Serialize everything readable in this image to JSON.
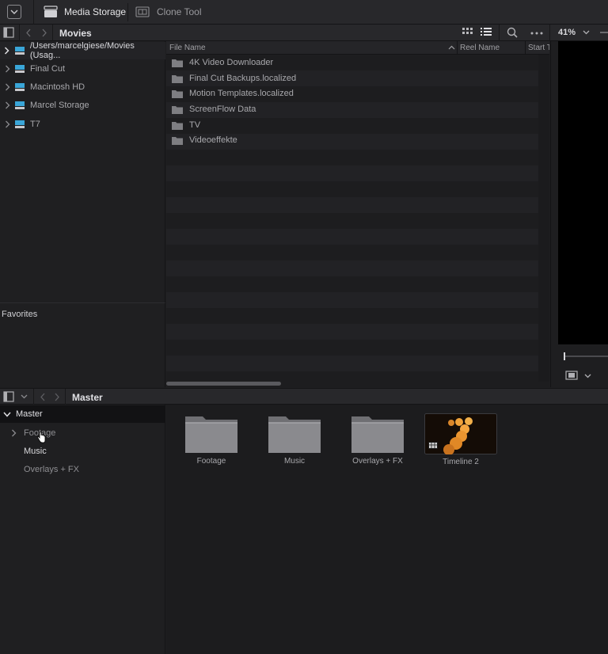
{
  "toolbar": {
    "tabs": [
      {
        "label": "Media Storage",
        "active": true
      },
      {
        "label": "Clone Tool",
        "active": false
      }
    ]
  },
  "pathbar": {
    "location": "Movies",
    "zoom": "41%"
  },
  "tree": {
    "items": [
      {
        "label": "/Users/marcelgiese/Movies (Usag...",
        "selected": true
      },
      {
        "label": "Final Cut"
      },
      {
        "label": "Macintosh HD"
      },
      {
        "label": "Marcel Storage"
      },
      {
        "label": "T7"
      }
    ]
  },
  "favorites": {
    "label": "Favorites"
  },
  "filelist": {
    "columns": [
      "File Name",
      "Reel Name",
      "Start T"
    ],
    "files": [
      "4K Video Downloader",
      "Final Cut Backups.localized",
      "Motion Templates.localized",
      "ScreenFlow Data",
      "TV",
      "Videoeffekte"
    ]
  },
  "bins": {
    "current": "Master",
    "tree_root": "Master",
    "tree_children": [
      "Footage",
      "Music",
      "Overlays + FX"
    ],
    "clips": [
      {
        "label": "Footage",
        "type": "folder"
      },
      {
        "label": "Music",
        "type": "folder"
      },
      {
        "label": "Overlays + FX",
        "type": "folder"
      },
      {
        "label": "Timeline 2",
        "type": "timeline"
      }
    ]
  },
  "colors": {
    "accent_drive": "#3aa6d8",
    "panel": "#1f1f21",
    "bar": "#28282b"
  }
}
